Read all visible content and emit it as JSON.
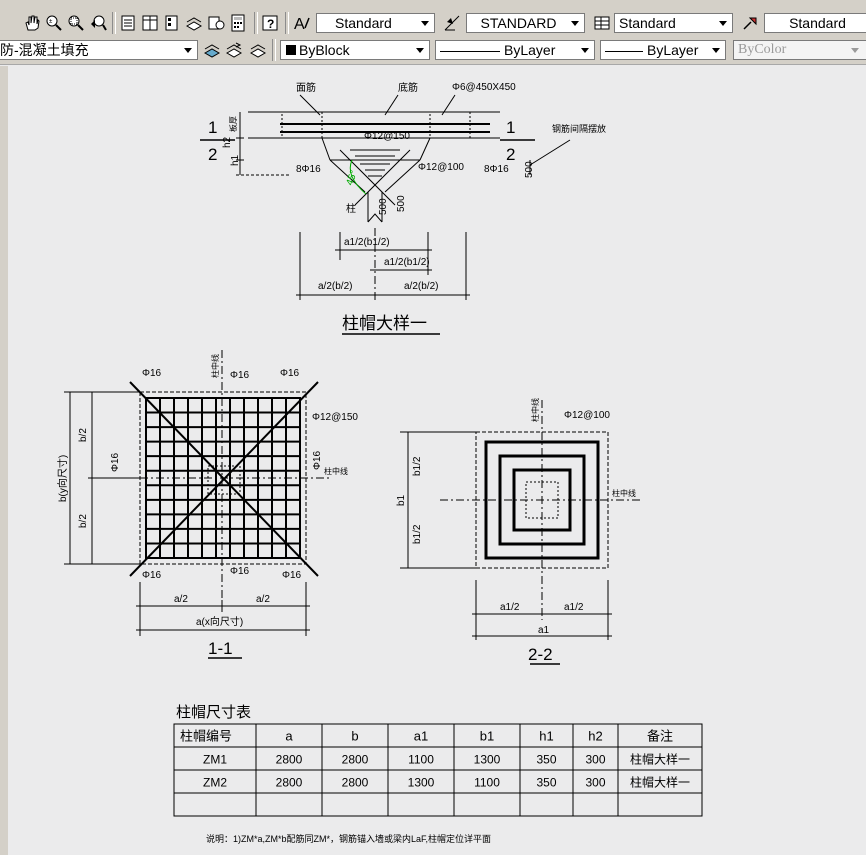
{
  "toolbar1": {
    "text_style": "Standard",
    "dim_style": "STANDARD",
    "table_style": "Standard",
    "mleader_style": "Standard",
    "icons": [
      "pan-icon",
      "zoom-realtime-icon",
      "zoom-window-icon",
      "zoom-previous-icon",
      "properties-icon",
      "design-center-icon",
      "tool-palettes-icon",
      "sheet-set-icon",
      "markup-icon",
      "quickcalc-icon",
      "help-icon",
      "text-style-icon",
      "dim-style-icon",
      "table-style-icon",
      "mleader-style-icon"
    ]
  },
  "toolbar2": {
    "layer": "防-混凝土填充",
    "color": "ByBlock",
    "linetype": "ByLayer",
    "lineweight": "ByLayer",
    "plotstyle": "ByColor"
  },
  "drawing": {
    "top_detail": {
      "label_face_bar": "面筋",
      "label_bottom_bar": "底筋",
      "label_phi_450": "Φ6@450X450",
      "label_phi12_150": "Φ12@150",
      "label_phi12_100": "Φ12@100",
      "label_8phi16_left": "8Φ16",
      "label_8phi16_right": "8Φ16",
      "label_column": "柱",
      "label_500a": "500",
      "label_500b": "500",
      "label_500c": "500",
      "label_angle": "45°",
      "label_h1": "h1",
      "label_h2": "h2",
      "label_slab": "板厚",
      "label_cut1_left": "1",
      "label_cut2_left": "2",
      "label_cut1_right": "1",
      "label_cut2_right": "2",
      "label_note": "钢筋间隔摆放",
      "dim_a1b1_1": "a1/2(b1/2)",
      "dim_a1b1_2": "a1/2(b1/2)",
      "dim_ab_left": "a/2(b/2)",
      "dim_ab_right": "a/2(b/2)",
      "title": "柱帽大样一"
    },
    "section11": {
      "phi16": "Φ16",
      "phi12_150": "Φ12@150",
      "col_center_v": "柱中线",
      "col_center_h": "柱中线",
      "dim_b2_top": "b/2",
      "dim_b2_bot": "b/2",
      "dim_b": "b(y向尺寸)",
      "dim_a2_left": "a/2",
      "dim_a2_right": "a/2",
      "dim_a": "a(x向尺寸)",
      "title": "1-1"
    },
    "section22": {
      "phi12_100": "Φ12@100",
      "col_center_v": "柱中线",
      "col_center_h": "柱中线",
      "dim_b12_top": "b1/2",
      "dim_b12_bot": "b1/2",
      "dim_b1": "b1",
      "dim_a12_left": "a1/2",
      "dim_a12_right": "a1/2",
      "dim_a1": "a1",
      "title": "2-2"
    },
    "table": {
      "title": "柱帽尺寸表",
      "headers": [
        "柱帽编号",
        "a",
        "b",
        "a1",
        "b1",
        "h1",
        "h2",
        "备注"
      ],
      "rows": [
        [
          "ZM1",
          "2800",
          "2800",
          "1100",
          "1300",
          "350",
          "300",
          "柱帽大样一"
        ],
        [
          "ZM2",
          "2800",
          "2800",
          "1300",
          "1100",
          "350",
          "300",
          "柱帽大样一"
        ],
        [
          "",
          "",
          "",
          "",
          "",
          "",
          "",
          ""
        ]
      ]
    },
    "note": "说明：1)ZM*a,ZM*b配筋同ZM*，钢筋锚入墙或梁内LaF,柱帽定位详平面"
  }
}
